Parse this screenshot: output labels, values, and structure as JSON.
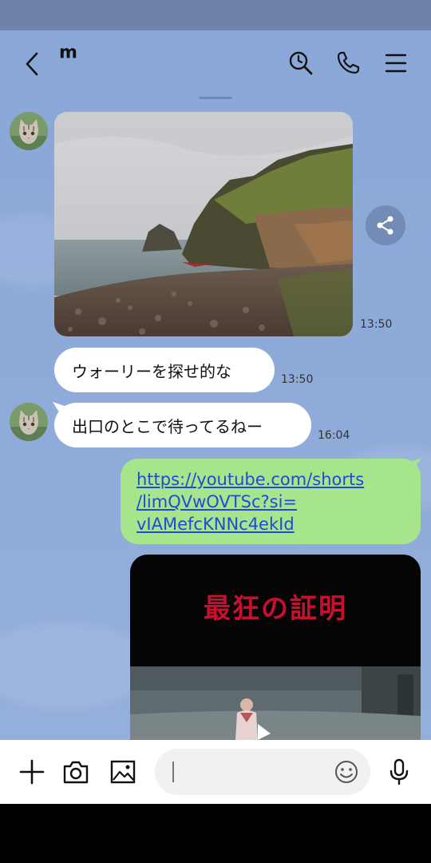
{
  "header": {
    "title": "m"
  },
  "icons": {
    "back": "chevron-left",
    "search": "clock-search",
    "call": "phone",
    "menu": "hamburger",
    "share": "share",
    "add": "plus",
    "camera": "camera",
    "image": "image",
    "emoji": "smiley",
    "mic": "microphone"
  },
  "messages": [
    {
      "id": "photo",
      "type": "image",
      "sender": "other",
      "time": "13:50"
    },
    {
      "id": "m1",
      "type": "text",
      "sender": "other",
      "text": "ウォーリーを探せ的な",
      "time": "13:50"
    },
    {
      "id": "m2",
      "type": "text",
      "sender": "other",
      "text": "出口のとこで待ってるねー",
      "time": "16:04"
    },
    {
      "id": "m3",
      "type": "link",
      "sender": "me",
      "lines": [
        "https://youtube.com/shorts",
        "/limQVwOVTSc?si=",
        "vIAMefcKNNc4ekId"
      ]
    },
    {
      "id": "m4",
      "type": "video",
      "sender": "me",
      "title": "最狂の証明"
    }
  ],
  "colors": {
    "chat_bg": "#8aa7d8",
    "my_bubble": "#a6e58c",
    "link": "#1f4bd8",
    "video_title": "#c8102e"
  }
}
